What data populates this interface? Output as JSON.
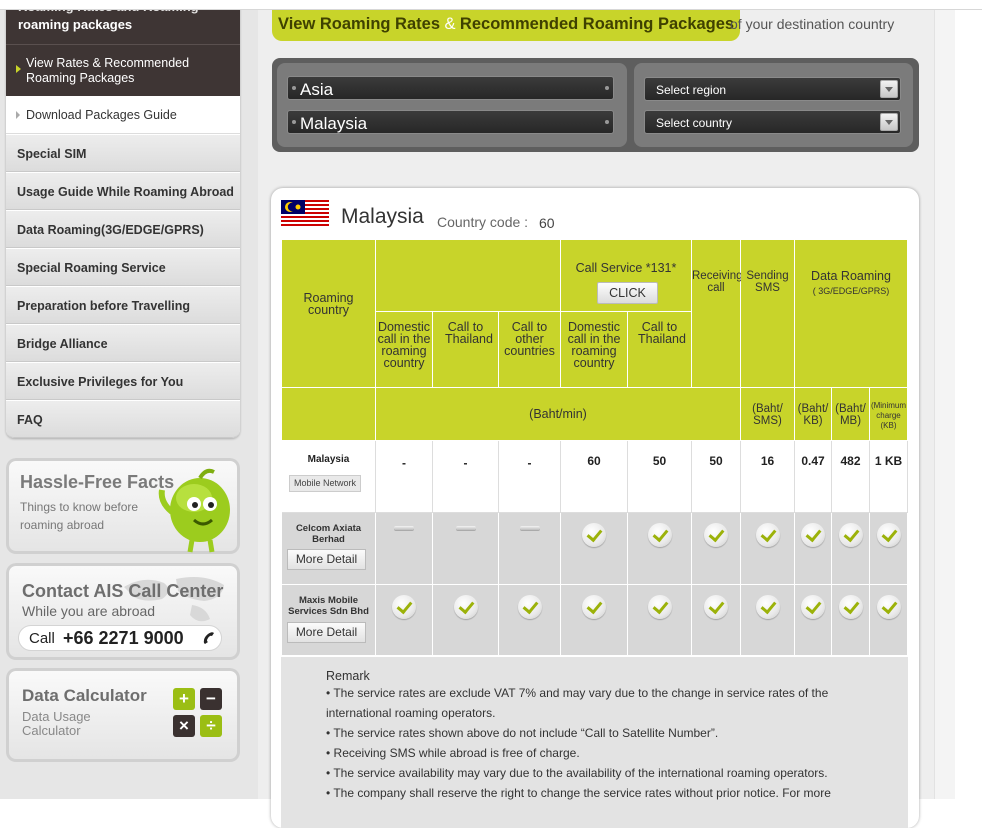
{
  "sidebar": {
    "menu_top": "roaming packages",
    "menu_top_cut": "Roaming Rates and Roaming",
    "active_item": "View Rates & Recommended Roaming Packages",
    "sub_item": "Download Packages Guide",
    "items": [
      {
        "label": "Special SIM"
      },
      {
        "label": "Usage Guide While Roaming Abroad"
      },
      {
        "label": "Data Roaming(3G/EDGE/GPRS)"
      },
      {
        "label": "Special Roaming Service"
      },
      {
        "label": "Preparation before Travelling"
      },
      {
        "label": "Bridge Alliance"
      },
      {
        "label": "Exclusive Privileges for You"
      },
      {
        "label": "FAQ"
      }
    ],
    "hassle": {
      "title": "Hassle-Free Facts",
      "subtitle": "Things to know before roaming abroad"
    },
    "contact": {
      "title": "Contact AIS Call Center",
      "subtitle": "While you are abroad",
      "call_label": "Call",
      "phone": "+66 2271 9000"
    },
    "calculator": {
      "title": "Data Calculator",
      "subtitle": "Data Usage Calculator",
      "buttons": [
        "+",
        "−",
        "×",
        "÷"
      ]
    }
  },
  "header": {
    "title_part1": "View Roaming Rates",
    "ampersand": "&",
    "title_part2": "Recommended Roaming Packages",
    "suffix": "of your destination country"
  },
  "selector": {
    "region_value": "Asia",
    "country_value": "Malaysia",
    "region_select": "Select region",
    "country_select": "Select country"
  },
  "country": {
    "name": "Malaysia",
    "code_label": "Country code :",
    "code": "60"
  },
  "table": {
    "header": {
      "roaming_country": "Roaming country",
      "call_service": "Call Service *131*",
      "click_button": "CLICK",
      "receiving_call": "Receiving call",
      "sending_sms": "Sending SMS",
      "data_roaming": "Data Roaming",
      "data_roaming_sub": "( 3G/EDGE/GPRS)",
      "domestic_call": "Domestic call in the roaming country",
      "call_thailand": "Call to Thailand",
      "call_other": "Call to other countries",
      "domestic_call_2": "Domestic call in the roaming country",
      "call_thailand_2": "Call to Thailand",
      "unit_baht_min": "(Baht/min)",
      "unit_baht_sms": "(Baht/ SMS)",
      "unit_baht_kb": "(Baht/ KB)",
      "unit_baht_mb": "(Baht/ MB)",
      "unit_min_charge": "(Minimum charge (KB)"
    },
    "rates_row": {
      "country": "Malaysia",
      "network_badge": "Mobile Network",
      "values": [
        "-",
        "-",
        "-",
        "60",
        "50",
        "50",
        "16",
        "0.47",
        "482",
        "1 KB"
      ]
    },
    "operators": [
      {
        "name": "Celcom Axiata Berhad",
        "button": "More Detail",
        "cells": [
          "dash",
          "dash",
          "dash",
          "check",
          "check",
          "check",
          "check",
          "check",
          "check",
          "check"
        ]
      },
      {
        "name": "Maxis Mobile Services Sdn Bhd",
        "button": "More Detail",
        "cells": [
          "check",
          "check",
          "check",
          "check",
          "check",
          "check",
          "check",
          "check",
          "check",
          "check"
        ]
      }
    ]
  },
  "remark": {
    "title": "Remark",
    "items": [
      "• The service rates are exclude VAT 7% and may vary due to the change in service rates of the international roaming operators.",
      "• The service rates shown above do not include “Call to Satellite Number”.",
      "• Receiving SMS while abroad is free of charge.",
      "• The service availability may vary due to the availability of the international roaming operators.",
      "• The company shall reserve the right to change the service rates without prior notice. For more"
    ]
  },
  "colors": {
    "accent": "#c8d42a",
    "dark": "#3e3534",
    "selector": "#5e5e5e"
  }
}
